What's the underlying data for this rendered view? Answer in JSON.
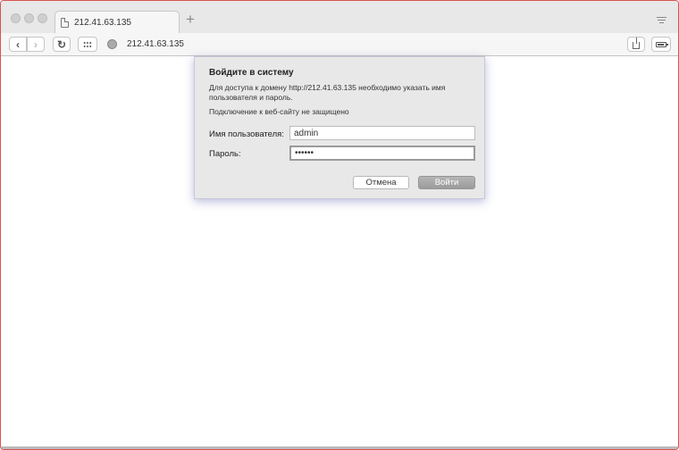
{
  "browser": {
    "tab_title": "212.41.63.135",
    "new_tab_label": "+",
    "address": "212.41.63.135",
    "back_label": "‹",
    "forward_label": "›",
    "reload_label": "↻"
  },
  "dialog": {
    "title": "Войдите в систему",
    "message": "Для доступа к домену http://212.41.63.135 необходимо указать имя пользователя и пароль.",
    "warning": "Подключение к веб-сайту не защищено",
    "username_label": "Имя пользователя:",
    "username_value": "admin",
    "password_label": "Пароль:",
    "password_value": "••••••",
    "cancel_label": "Отмена",
    "login_label": "Войти"
  },
  "icons": {
    "page": "page-icon",
    "globe": "globe-icon",
    "share": "share-icon",
    "battery": "battery-icon",
    "menu": "menu-icon",
    "grid": "grid-icon"
  }
}
